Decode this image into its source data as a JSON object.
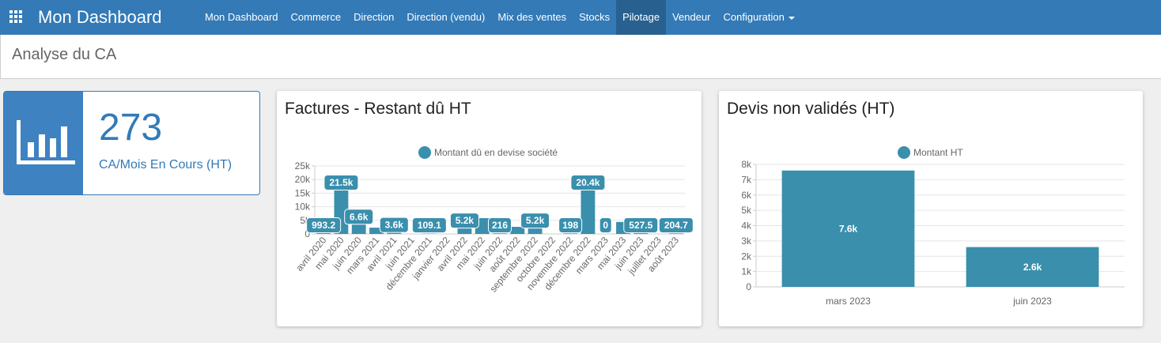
{
  "navbar": {
    "menu_icon": "apps-grid-icon",
    "brand": "Mon Dashboard",
    "items": [
      {
        "label": "Mon Dashboard"
      },
      {
        "label": "Commerce"
      },
      {
        "label": "Direction"
      },
      {
        "label": "Direction (vendu)"
      },
      {
        "label": "Mix des ventes"
      },
      {
        "label": "Stocks"
      },
      {
        "label": "Pilotage",
        "active": true
      },
      {
        "label": "Vendeur"
      },
      {
        "label": "Configuration",
        "dropdown": true
      }
    ],
    "color": "#337ab7",
    "active_color": "#286090"
  },
  "page": {
    "title": "Analyse du CA"
  },
  "stat_card": {
    "icon": "bar-chart-icon",
    "value": "273",
    "label": "CA/Mois En Cours (HT)",
    "color": "#337ab7"
  },
  "chart_data": [
    {
      "type": "bar",
      "title": "Factures - Restant dû HT",
      "legend": "Montant dû en devise société",
      "legend_position": "top",
      "series_color": "#3a8fad",
      "grid": true,
      "ylim": [
        0,
        25000
      ],
      "yticks": [
        "0",
        "5k",
        "10k",
        "15k",
        "20k",
        "25k"
      ],
      "categories": [
        "avril 2020",
        "mai 2020",
        "juin 2020",
        "mars 2021",
        "avril 2021",
        "juin 2021",
        "décembre 2021",
        "janvier 2022",
        "avril 2022",
        "mai 2022",
        "juin 2022",
        "août 2022",
        "septembre 2022",
        "octobre 2022",
        "novembre 2022",
        "décembre 2022",
        "mars 2023",
        "mai 2023",
        "juin 2023",
        "juillet 2023",
        "août 2023"
      ],
      "values": [
        993.2,
        21500,
        6600,
        2300,
        3600,
        0,
        109.1,
        0,
        5200,
        5800,
        216,
        2600,
        5200,
        0,
        198,
        20400,
        0,
        4400,
        527.5,
        0,
        204.7
      ],
      "data_labels": [
        "993.2",
        "21.5k",
        "6.6k",
        "",
        "3.6k",
        "",
        "109.1",
        "",
        "5.2k",
        "",
        "216",
        "",
        "5.2k",
        "",
        "198",
        "20.4k",
        "0",
        "",
        "527.5",
        "",
        "204.7"
      ]
    },
    {
      "type": "bar",
      "title": "Devis non validés (HT)",
      "legend": "Montant HT",
      "legend_position": "top",
      "series_color": "#3a8fad",
      "grid": true,
      "ylim": [
        0,
        8000
      ],
      "yticks": [
        "0",
        "1k",
        "2k",
        "3k",
        "4k",
        "5k",
        "6k",
        "7k",
        "8k"
      ],
      "categories": [
        "mars 2023",
        "juin 2023"
      ],
      "values": [
        7600,
        2600
      ],
      "data_labels": [
        "7.6k",
        "2.6k"
      ]
    }
  ]
}
